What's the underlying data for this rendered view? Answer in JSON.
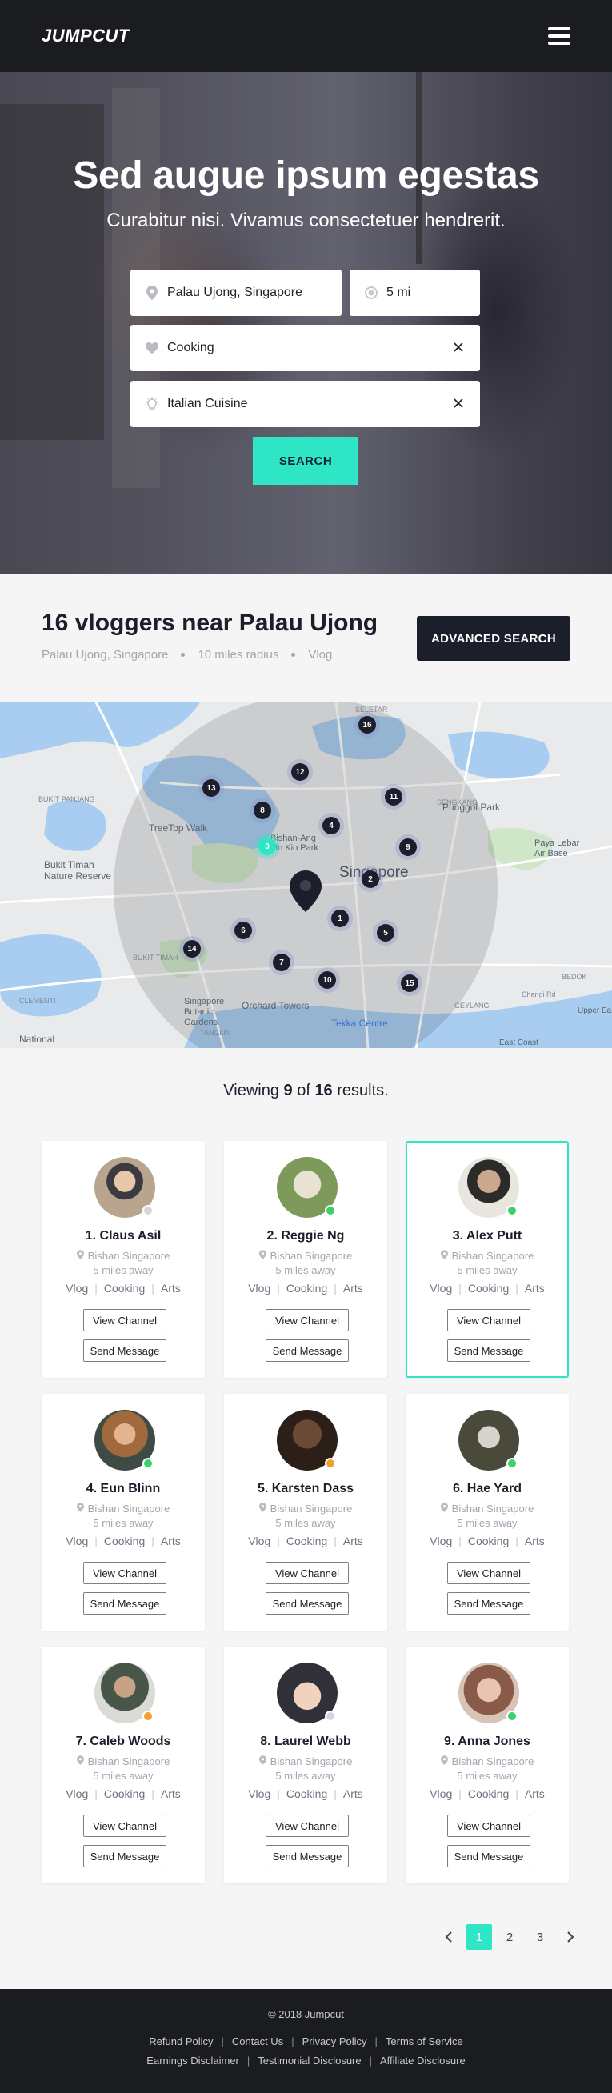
{
  "header": {
    "logo": "JUMPCUT",
    "menu_icon": "hamburger-icon"
  },
  "hero": {
    "title": "Sed augue ipsum egestas",
    "subtitle": "Curabitur nisi. Vivamus consectetuer hendrerit.",
    "location_value": "Palau Ujong, Singapore",
    "radius_value": "5 mi",
    "interest_value": "Cooking",
    "cuisine_value": "Italian Cuisine",
    "search_label": "SEARCH"
  },
  "results": {
    "title": "16 vloggers near Palau Ujong",
    "meta": [
      "Palau Ujong, Singapore",
      "10 miles radius",
      "Vlog"
    ],
    "advanced_label": "ADVANCED SEARCH"
  },
  "map": {
    "labels": [
      "SELETAR",
      "BUKIT PANJANG",
      "SENGKANG",
      "TreeTop Walk",
      "Punggol Park",
      "Bishan-Ang Mo Kio Park",
      "Bukit Timah Nature Reserve",
      "Singapore",
      "Paya Lebar Air Base",
      "BUKIT TIMAH",
      "Singapore Botanic Gardens",
      "Orchard Towers",
      "Tekka Centre",
      "TANGLIN",
      "GEYLANG",
      "BEDOK",
      "CLEMENTI",
      "National",
      "East Coast",
      "Changi Rd",
      "Upper Ea"
    ],
    "markers": [
      "16",
      "12",
      "13",
      "8",
      "11",
      "4",
      "3",
      "9",
      "2",
      "6",
      "1",
      "5",
      "14",
      "7",
      "10",
      "15"
    ]
  },
  "viewing": {
    "prefix": "Viewing ",
    "shown": "9",
    "middle": " of ",
    "total": "16",
    "suffix": " results."
  },
  "cards": [
    {
      "name": "1. Claus Asil",
      "location": "Bishan Singapore",
      "distance": "5 miles away",
      "tags": [
        "Vlog",
        "Cooking",
        "Arts"
      ],
      "status_color": "#d4d6db",
      "view_label": "View Channel",
      "message_label": "Send Message"
    },
    {
      "name": "2. Reggie Ng",
      "location": "Bishan Singapore",
      "distance": "5 miles away",
      "tags": [
        "Vlog",
        "Cooking",
        "Arts"
      ],
      "status_color": "#3ad26b",
      "view_label": "View Channel",
      "message_label": "Send Message"
    },
    {
      "name": "3. Alex Putt",
      "location": "Bishan Singapore",
      "distance": "5 miles away",
      "tags": [
        "Vlog",
        "Cooking",
        "Arts"
      ],
      "status_color": "#3ad26b",
      "view_label": "View Channel",
      "message_label": "Send Message"
    },
    {
      "name": "4. Eun Blinn",
      "location": "Bishan Singapore",
      "distance": "5 miles away",
      "tags": [
        "Vlog",
        "Cooking",
        "Arts"
      ],
      "status_color": "#3ad26b",
      "view_label": "View Channel",
      "message_label": "Send Message"
    },
    {
      "name": "5. Karsten Dass",
      "location": "Bishan Singapore",
      "distance": "5 miles away",
      "tags": [
        "Vlog",
        "Cooking",
        "Arts"
      ],
      "status_color": "#f0a030",
      "view_label": "View Channel",
      "message_label": "Send Message"
    },
    {
      "name": "6. Hae Yard",
      "location": "Bishan Singapore",
      "distance": "5 miles away",
      "tags": [
        "Vlog",
        "Cooking",
        "Arts"
      ],
      "status_color": "#3ad26b",
      "view_label": "View Channel",
      "message_label": "Send Message"
    },
    {
      "name": "7. Caleb Woods",
      "location": "Bishan Singapore",
      "distance": "5 miles away",
      "tags": [
        "Vlog",
        "Cooking",
        "Arts"
      ],
      "status_color": "#f0a030",
      "view_label": "View Channel",
      "message_label": "Send Message"
    },
    {
      "name": "8. Laurel Webb",
      "location": "Bishan Singapore",
      "distance": "5 miles away",
      "tags": [
        "Vlog",
        "Cooking",
        "Arts"
      ],
      "status_color": "#d4d6db",
      "view_label": "View Channel",
      "message_label": "Send Message"
    },
    {
      "name": "9. Anna Jones",
      "location": "Bishan Singapore",
      "distance": "5 miles away",
      "tags": [
        "Vlog",
        "Cooking",
        "Arts"
      ],
      "status_color": "#3ad26b",
      "view_label": "View Channel",
      "message_label": "Send Message"
    }
  ],
  "pagination": {
    "pages": [
      "1",
      "2",
      "3"
    ],
    "active": "1"
  },
  "footer": {
    "copyright": "© 2018 Jumpcut",
    "links_row1": [
      "Refund Policy",
      "Contact Us",
      "Privacy Policy",
      "Terms of Service"
    ],
    "links_row2": [
      "Earnings Disclaimer",
      "Testimonial Disclosure",
      "Affiliate Disclosure"
    ]
  },
  "colors": {
    "accent": "#2ee6c5",
    "dark": "#1b1c20",
    "muted": "#a3a6b1"
  }
}
